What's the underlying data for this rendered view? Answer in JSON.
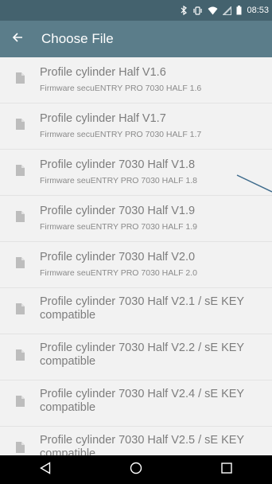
{
  "status_bar": {
    "time": "08:53",
    "icons": [
      "bluetooth-icon",
      "vibrate-icon",
      "wifi-icon",
      "signal-icon",
      "battery-icon"
    ]
  },
  "app_bar": {
    "title": "Choose File",
    "back_icon": "arrow-back-icon"
  },
  "files": [
    {
      "title": "Profile cylinder Half V1.6",
      "subtitle": "Firmware secuENTRY PRO 7030 HALF  1.6"
    },
    {
      "title": "Profile cylinder Half V1.7",
      "subtitle": "Firmware secuENTRY PRO 7030 HALF  1.7"
    },
    {
      "title": "Profile cylinder 7030 Half V1.8",
      "subtitle": "Firmware seuENTRY PRO 7030 HALF  1.8"
    },
    {
      "title": "Profile cylinder 7030 Half V1.9",
      "subtitle": "Firmware seuENTRY PRO 7030 HALF  1.9"
    },
    {
      "title": "Profile cylinder 7030 Half V2.0",
      "subtitle": "Firmware seuENTRY PRO 7030 HALF  2.0"
    },
    {
      "title": "Profile cylinder 7030 Half V2.1 / sE KEY",
      "title2": "compatible"
    },
    {
      "title": "Profile cylinder 7030 Half V2.2 / sE KEY",
      "title2": "compatible"
    },
    {
      "title": "Profile cylinder 7030 Half V2.4 / sE KEY",
      "title2": "compatible"
    },
    {
      "title": "Profile cylinder 7030 Half V2.5 / sE KEY",
      "title2": "compatible"
    }
  ],
  "nav_bar": {
    "icons": [
      "nav-back-icon",
      "nav-home-icon",
      "nav-recents-icon"
    ]
  },
  "colors": {
    "status_bar": "#44626e",
    "app_bar": "#5b7d8a",
    "annotation_line": "#3e6b8c"
  }
}
